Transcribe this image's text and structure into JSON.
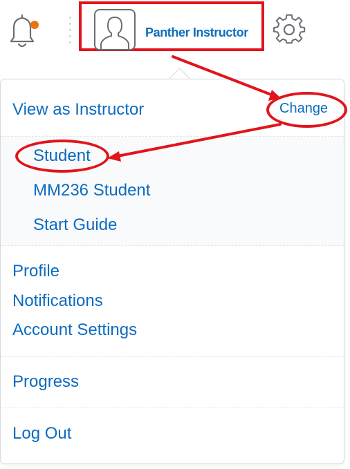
{
  "header": {
    "user_name": "Panther Instructor",
    "icons": {
      "notifications": "bell-icon",
      "avatar": "user-avatar-icon",
      "settings": "gear-icon"
    },
    "notification_dot_color": "#e87511"
  },
  "menu": {
    "role": {
      "label": "View as Instructor",
      "change_label": "Change"
    },
    "role_options": [
      "Student",
      "MM236 Student",
      "Start Guide"
    ],
    "account_links": [
      "Profile",
      "Notifications",
      "Account Settings"
    ],
    "progress_label": "Progress",
    "logout_label": "Log Out"
  },
  "annotation_color": "#e2141c",
  "link_color": "#0b6bbf"
}
